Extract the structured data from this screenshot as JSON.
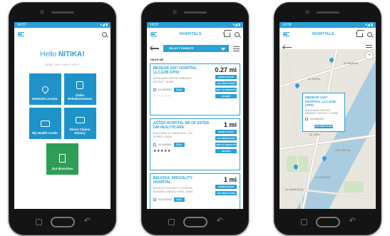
{
  "colors": {
    "accent": "#2aa1d8",
    "tile": "#1f93c9",
    "tile_green": "#2e9e57"
  },
  "screen1": {
    "status_time": "14:57",
    "greeting": "Hello ",
    "user_name": "NITIKA!",
    "help_text": "HOW CAN I HELP YOU?",
    "tiles": [
      {
        "label": "Network Locator",
        "icon": "location-pin-icon"
      },
      {
        "label": "Claim Reimbursement",
        "icon": "document-icon"
      },
      {
        "label": "My Health Cards",
        "icon": "health-card-icon"
      },
      {
        "label": "Direct Claims History",
        "icon": "claims-history-icon"
      },
      {
        "label": "Our Branches",
        "icon": "building-icon"
      }
    ]
  },
  "screen2": {
    "status_time": "14:57",
    "title": "HOSPITALS",
    "select_label": "SELECT EMIRATE",
    "near_me": "NEAR ME",
    "hospitals": [
      {
        "name": "MEDEOR 24X7 HOSPITAL LLC,EXB (VPS)",
        "distance": "0.27 mi",
        "address": "BURJUMAN CENTER, EMBASSY DISTRICT, DUBAI",
        "phone": "04-3332933",
        "rating": "☆☆☆☆☆"
      },
      {
        "name": "ASTER HOSPITAL BR OF ASTER DM HEALTHCARE",
        "distance": "1 mi",
        "address": "BUR DUBAI, AL MANKHOOL, 19 A STREET, DUBAI",
        "phone": "04-4430500",
        "rating": "★★★★★"
      },
      {
        "name": "BELHOUL SPECIALITY HOSPITAL",
        "distance": "1 mi",
        "address": "BELHOUL SPECIALITY HOSPITAL BUILDING, KHALID, ROAD, DUBAI",
        "phone": "04-2733333",
        "rating": ""
      }
    ],
    "call_label": "CALL",
    "btn_labels": [
      "SHOW ON MAP",
      "GET DIRECTIONS",
      "ADD TO CONTACTS",
      "ON MAP"
    ]
  },
  "screen3": {
    "status_time": "14:59",
    "title": "HOSPITALS",
    "popup": {
      "name": "MEDEOR 24X7 HOSPITAL LLC,EXB (VPS)",
      "address": "BURJUMAN CENTER, EMBASSY DISTRICT, DUBAI",
      "phone": "04-3332933",
      "button": "GET DIRECTIONS"
    },
    "map_labels": [
      "AL RAFFA",
      "AL HAMRIYA",
      "AL KARAMA",
      "AL MANKHOOL",
      "OUD METHA",
      "AL BARSHA",
      "AL WASL"
    ]
  }
}
